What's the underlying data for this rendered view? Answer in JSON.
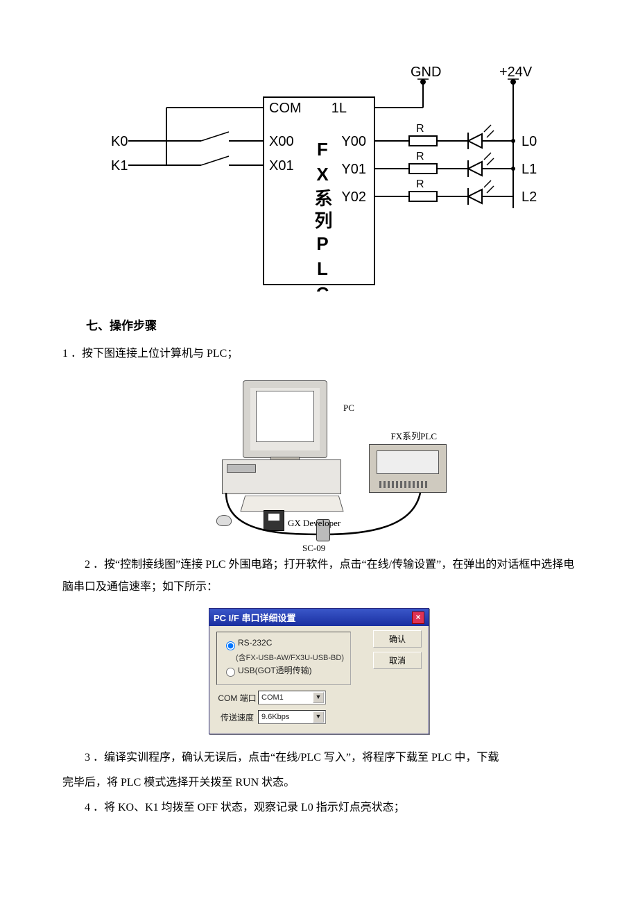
{
  "fig1": {
    "inputs": {
      "k0": "K0",
      "k1": "K1"
    },
    "plc_label": "FX系列PLC",
    "left_ports": {
      "com": "COM",
      "x00": "X00",
      "x01": "X01"
    },
    "right_ports": {
      "oneL": "1L",
      "y00": "Y00",
      "y01": "Y01",
      "y02": "Y02"
    },
    "power": {
      "gnd": "GND",
      "v24": "+24V"
    },
    "r": "R",
    "leds": {
      "l0": "L0",
      "l1": "L1",
      "l2": "L2"
    }
  },
  "section7": {
    "title": "七、操作步骤"
  },
  "step1": "1 ．按下图连接上位计算机与 PLC；",
  "fig2": {
    "pc": "PC",
    "gx": "GX Developer",
    "plc": "FX系列PLC",
    "cable": "SC-09"
  },
  "step2": "2 ．按“控制接线图”连接 PLC 外围电路；打开软件，点击“在线/传输设置”，在弹出的对话框中选择电脑串口及通信速率；如下所示：",
  "dialog": {
    "title": "PC I/F 串口详细设置",
    "rs232": "RS-232C",
    "rs232_sub": "(含FX-USB-AW/FX3U-USB-BD)",
    "usb": "USB(GOT透明传输)",
    "com_label": "COM 端口",
    "com_value": "COM1",
    "baud_label": "传送速度",
    "baud_value": "9.6Kbps",
    "ok": "确认",
    "cancel": "取消"
  },
  "step3a": "3 ．编译实训程序，确认无误后，点击“在线/PLC 写入”，将程序下载至 PLC 中，下载",
  "step3b": "完毕后，将 PLC 模式选择开关拨至 RUN 状态。",
  "step4": "4 ．将 KO、K1 均拨至 OFF 状态，观察记录 L0 指示灯点亮状态；"
}
